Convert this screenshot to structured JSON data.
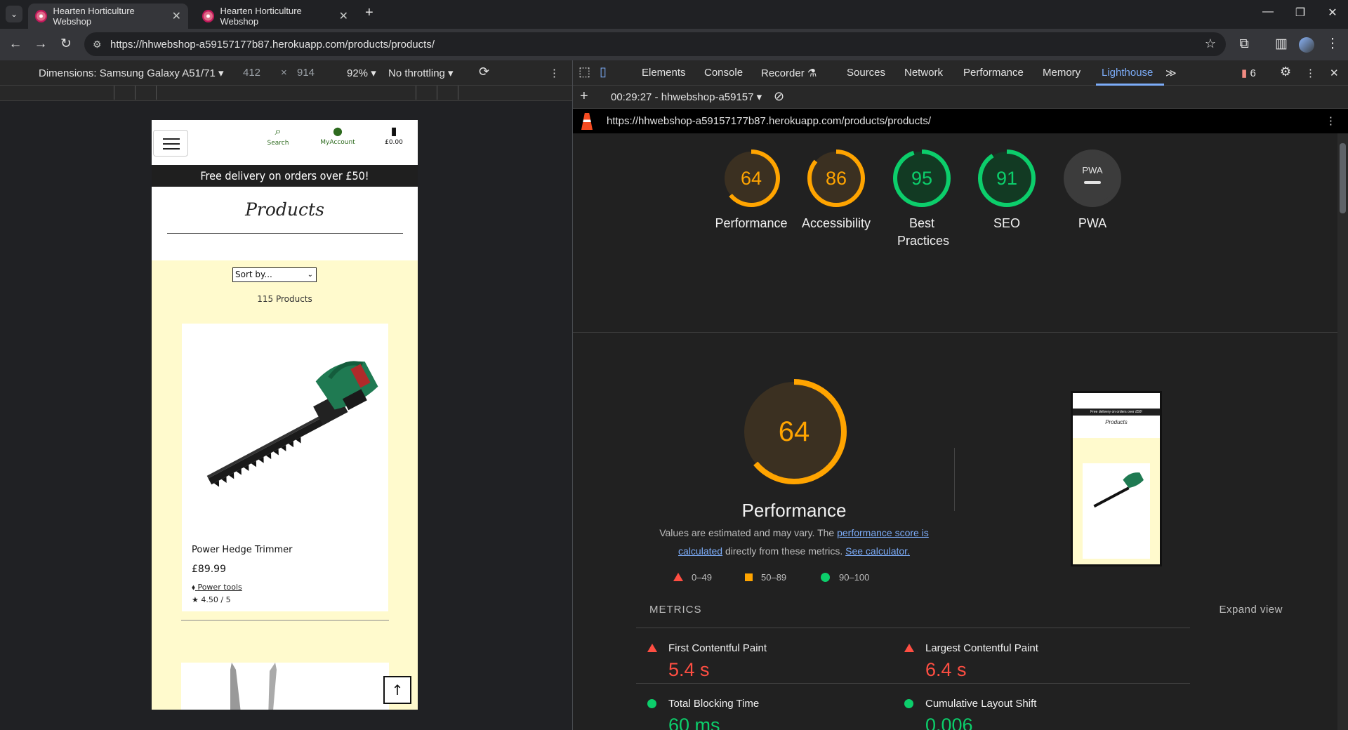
{
  "browser": {
    "tabs": [
      {
        "title": "Hearten Horticulture Webshop"
      },
      {
        "title": "Hearten Horticulture Webshop"
      }
    ],
    "url": "https://hhwebshop-a59157177b87.herokuapp.com/products/products/"
  },
  "device_toolbar": {
    "dimensions_label": "Dimensions: Samsung Galaxy A51/71",
    "width": "412",
    "height": "914",
    "zoom": "92%",
    "throttling": "No throttling"
  },
  "site": {
    "header": {
      "search_label": "Search",
      "account_label": "MyAccount",
      "bag_total": "£0.00"
    },
    "banner": "Free delivery on orders over £50!",
    "page_title": "Products",
    "sort_select": "Sort by...",
    "product_count": "115 Products",
    "products": [
      {
        "name": "Power Hedge Trimmer",
        "price": "£89.99",
        "category": "Power tools",
        "rating": "4.50 / 5"
      }
    ],
    "back_to_top": "↑"
  },
  "devtools": {
    "tabs": [
      "Elements",
      "Console",
      "Recorder",
      "Sources",
      "Network",
      "Performance",
      "Memory",
      "Lighthouse"
    ],
    "issues_count": "6",
    "report_selector": "00:29:27 - hhwebshop-a59157",
    "report_url": "https://hhwebshop-a59157177b87.herokuapp.com/products/products/",
    "categories": [
      {
        "score": "64",
        "label": "Performance",
        "color": "#ffa400",
        "fraction": 0.64
      },
      {
        "score": "86",
        "label": "Accessibility",
        "color": "#ffa400",
        "fraction": 0.86
      },
      {
        "score": "95",
        "label": "Best Practices",
        "color": "#0cce6b",
        "fraction": 0.95
      },
      {
        "score": "91",
        "label": "SEO",
        "color": "#0cce6b",
        "fraction": 0.91
      },
      {
        "score": "PWA",
        "label": "PWA",
        "color": "#9aa0a6",
        "fraction": 0
      }
    ],
    "performance": {
      "score": "64",
      "fraction": 0.64,
      "title": "Performance",
      "desc_prefix": "Values are estimated and may vary. The ",
      "desc_link1": "performance score is calculated",
      "desc_middle": " directly from these metrics. ",
      "desc_link2": "See calculator.",
      "legend": [
        "0–49",
        "50–89",
        "90–100"
      ]
    },
    "metrics_heading": "METRICS",
    "expand_view": "Expand view",
    "metrics": [
      {
        "title": "First Contentful Paint",
        "value": "5.4 s",
        "status": "fail",
        "color": "#ff4e42"
      },
      {
        "title": "Largest Contentful Paint",
        "value": "6.4 s",
        "status": "fail",
        "color": "#ff4e42"
      },
      {
        "title": "Total Blocking Time",
        "value": "60 ms",
        "status": "pass",
        "color": "#0cce6b"
      },
      {
        "title": "Cumulative Layout Shift",
        "value": "0.006",
        "status": "pass",
        "color": "#0cce6b"
      }
    ],
    "thumb": {
      "banner": "Free delivery on orders over £50!",
      "title": "Products"
    }
  }
}
